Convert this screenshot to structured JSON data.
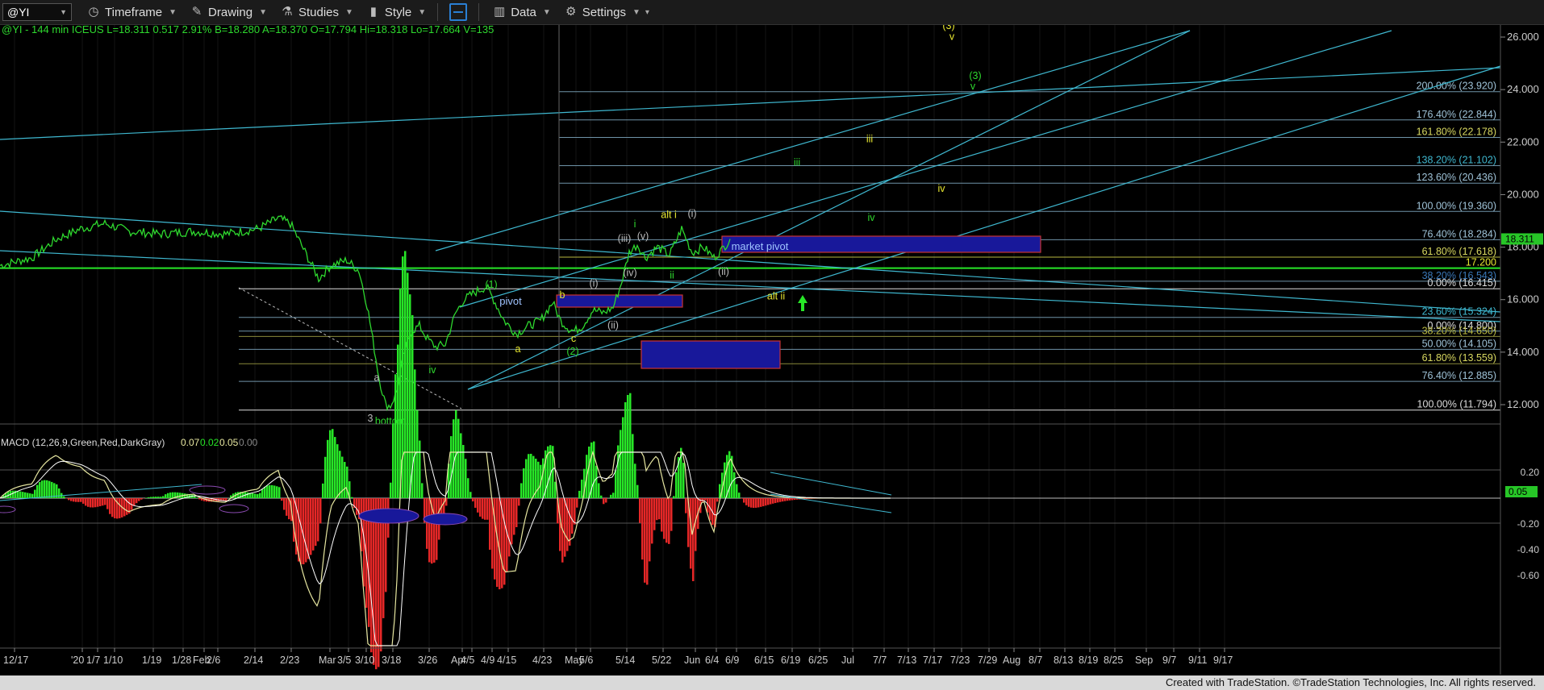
{
  "toolbar": {
    "symbol": "@YI",
    "timeframe": "Timeframe",
    "drawing": "Drawing",
    "studies": "Studies",
    "style": "Style",
    "data": "Data",
    "settings": "Settings"
  },
  "header": "@YI - 144 min  ICEUS  L=18.311  0.517  2.91%  B=18.280  A=18.370  O=17.794  Hi=18.318  Lo=17.664  V=135",
  "macd_label": "MACD (12,26,9,Green,Red,DarkGray)",
  "macd_values": [
    "0.07",
    "0.02",
    "0.05",
    "0.00"
  ],
  "footer": "Created with TradeStation. ©TradeStation Technologies, Inc. All rights reserved.",
  "colors": {
    "price": "#2ed82e",
    "channel": "#3fb8d0",
    "fib": "#7fa9bf",
    "yellow": "#e8e830",
    "macd": "#e6e6a0",
    "hist_up": "#27e627",
    "hist_dn": "#e62727"
  },
  "chart_data": {
    "type": "line",
    "price_axis": {
      "ticks": [
        "26.000",
        "24.000",
        "22.000",
        "20.000",
        "18.000",
        "16.000",
        "14.000",
        "12.000"
      ],
      "ylim": [
        11.2,
        26.8
      ],
      "last": "18.311"
    },
    "macd_axis": {
      "ticks": [
        "0.20",
        "-0.20",
        "-0.40",
        "-0.60"
      ],
      "last": "0.05"
    },
    "x_ticks": [
      "12/17",
      "'20",
      "1/7",
      "1/10",
      "1/19",
      "1/28",
      "Feb",
      "2/6",
      "2/14",
      "2/23",
      "Mar",
      "3/5",
      "3/10",
      "3/18",
      "3/26",
      "Apr",
      "4/5",
      "4/9",
      "4/15",
      "4/23",
      "May",
      "5/6",
      "5/14",
      "5/22",
      "Jun",
      "6/4",
      "6/9",
      "6/15",
      "6/19",
      "6/25",
      "Jul",
      "7/7",
      "7/13",
      "7/17",
      "7/23",
      "7/29",
      "Aug",
      "8/7",
      "8/13",
      "8/19",
      "8/25",
      "Sep",
      "9/7",
      "9/11",
      "9/17"
    ],
    "price_series": [
      [
        0,
        17.3
      ],
      [
        40,
        17.6
      ],
      [
        70,
        18.3
      ],
      [
        100,
        18.7
      ],
      [
        130,
        18.9
      ],
      [
        160,
        18.6
      ],
      [
        200,
        18.5
      ],
      [
        240,
        18.6
      ],
      [
        280,
        18.5
      ],
      [
        320,
        18.7
      ],
      [
        345,
        19.1
      ],
      [
        360,
        18.9
      ],
      [
        380,
        17.7
      ],
      [
        395,
        16.8
      ],
      [
        410,
        17.3
      ],
      [
        430,
        17.5
      ],
      [
        445,
        17.1
      ],
      [
        455,
        15.8
      ],
      [
        462,
        14.5
      ],
      [
        470,
        13.0
      ],
      [
        478,
        12.0
      ],
      [
        484,
        11.95
      ],
      [
        492,
        12.5
      ],
      [
        500,
        13.8
      ],
      [
        510,
        14.8
      ],
      [
        520,
        15.0
      ],
      [
        530,
        14.5
      ],
      [
        540,
        14.2
      ],
      [
        552,
        14.3
      ],
      [
        565,
        15.5
      ],
      [
        575,
        16.0
      ],
      [
        590,
        16.3
      ],
      [
        603,
        16.5
      ],
      [
        612,
        16.0
      ],
      [
        625,
        15.2
      ],
      [
        640,
        14.7
      ],
      [
        655,
        15.0
      ],
      [
        670,
        15.2
      ],
      [
        685,
        15.9
      ],
      [
        695,
        15.2
      ],
      [
        705,
        14.9
      ],
      [
        712,
        14.8
      ],
      [
        722,
        15.0
      ],
      [
        735,
        15.6
      ],
      [
        748,
        15.5
      ],
      [
        760,
        15.7
      ],
      [
        770,
        16.6
      ],
      [
        780,
        17.8
      ],
      [
        790,
        18.1
      ],
      [
        800,
        17.6
      ],
      [
        815,
        18.0
      ],
      [
        830,
        17.7
      ],
      [
        845,
        18.7
      ],
      [
        858,
        17.8
      ],
      [
        872,
        18.0
      ],
      [
        885,
        17.6
      ],
      [
        895,
        17.9
      ],
      [
        905,
        18.31
      ]
    ],
    "fib_levels": [
      {
        "label": "200.00% (23.920)",
        "value": 23.92
      },
      {
        "label": "176.40% (22.844)",
        "value": 22.844
      },
      {
        "label": "161.80% (22.178)",
        "value": 22.178
      },
      {
        "label": "138.20% (21.102)",
        "value": 21.102
      },
      {
        "label": "123.60% (20.436)",
        "value": 20.436
      },
      {
        "label": "100.00% (19.360)",
        "value": 19.36
      },
      {
        "label": "76.40% (18.284)",
        "value": 18.284
      },
      {
        "label": "61.80% (17.618)",
        "value": 17.618
      },
      {
        "label": "17.200",
        "value": 17.2
      },
      {
        "label": "38.20% (16.543)",
        "value": 16.7
      },
      {
        "label": "0.00% (16.415)",
        "value": 16.415
      },
      {
        "label": "23.60% (15.324)",
        "value": 15.324
      },
      {
        "label": "0.00% (14.800)",
        "value": 14.8
      },
      {
        "label": "38.20% (14.650)",
        "value": 14.6
      },
      {
        "label": "50.00% (14.105)",
        "value": 14.105
      },
      {
        "label": "61.80% (13.559)",
        "value": 13.559
      },
      {
        "label": "76.40% (12.885)",
        "value": 12.885
      },
      {
        "label": "100.00% (11.794)",
        "value": 11.794
      }
    ],
    "annotations": [
      {
        "text": "(3)",
        "x": 1176,
        "y": 26.3,
        "color": "yellow"
      },
      {
        "text": "v",
        "x": 1180,
        "y": 25.9,
        "color": "yellow"
      },
      {
        "text": "(3)",
        "x": 1209,
        "y": 24.4,
        "color": "green"
      },
      {
        "text": "v",
        "x": 1206,
        "y": 24.0,
        "color": "green"
      },
      {
        "text": "iii",
        "x": 1078,
        "y": 22.0,
        "color": "yellow"
      },
      {
        "text": "iii",
        "x": 988,
        "y": 21.1,
        "color": "green"
      },
      {
        "text": "iv",
        "x": 1167,
        "y": 20.1,
        "color": "yellow"
      },
      {
        "text": "iv",
        "x": 1080,
        "y": 19.0,
        "color": "green"
      },
      {
        "text": "alt i",
        "x": 829,
        "y": 19.1,
        "color": "yellow"
      },
      {
        "text": "(i)",
        "x": 858,
        "y": 19.15,
        "color": "grey"
      },
      {
        "text": "i",
        "x": 787,
        "y": 18.75,
        "color": "green"
      },
      {
        "text": "(v)",
        "x": 797,
        "y": 18.3,
        "color": "grey"
      },
      {
        "text": "(iii)",
        "x": 774,
        "y": 18.2,
        "color": "grey"
      },
      {
        "text": "market pivot",
        "x": 942,
        "y": 17.9,
        "color": "label"
      },
      {
        "text": "(iv)",
        "x": 781,
        "y": 16.9,
        "color": "grey"
      },
      {
        "text": "ii",
        "x": 833,
        "y": 16.8,
        "color": "green"
      },
      {
        "text": "(ii)",
        "x": 897,
        "y": 16.95,
        "color": "grey"
      },
      {
        "text": "(i)",
        "x": 736,
        "y": 16.5,
        "color": "grey"
      },
      {
        "text": "(1)",
        "x": 609,
        "y": 16.45,
        "color": "green"
      },
      {
        "text": "pivot",
        "x": 633,
        "y": 15.8,
        "color": "label"
      },
      {
        "text": "b",
        "x": 697,
        "y": 16.05,
        "color": "yellow"
      },
      {
        "text": "(ii)",
        "x": 760,
        "y": 14.9,
        "color": "grey"
      },
      {
        "text": "c",
        "x": 711,
        "y": 14.4,
        "color": "yellow"
      },
      {
        "text": "alt ii",
        "x": 962,
        "y": 16.0,
        "color": "yellow"
      },
      {
        "text": "a",
        "x": 642,
        "y": 14.0,
        "color": "yellow"
      },
      {
        "text": "(2)",
        "x": 710,
        "y": 13.9,
        "color": "green"
      },
      {
        "text": "iii",
        "x": 505,
        "y": 14.6,
        "color": "green"
      },
      {
        "text": "iv",
        "x": 536,
        "y": 13.2,
        "color": "green"
      },
      {
        "text": "a",
        "x": 467,
        "y": 12.9,
        "color": "grey"
      },
      {
        "text": "3",
        "x": 459,
        "y": 11.35,
        "color": "grey"
      },
      {
        "text": "bottom",
        "x": 484,
        "y": 11.25,
        "color": "green"
      }
    ]
  }
}
